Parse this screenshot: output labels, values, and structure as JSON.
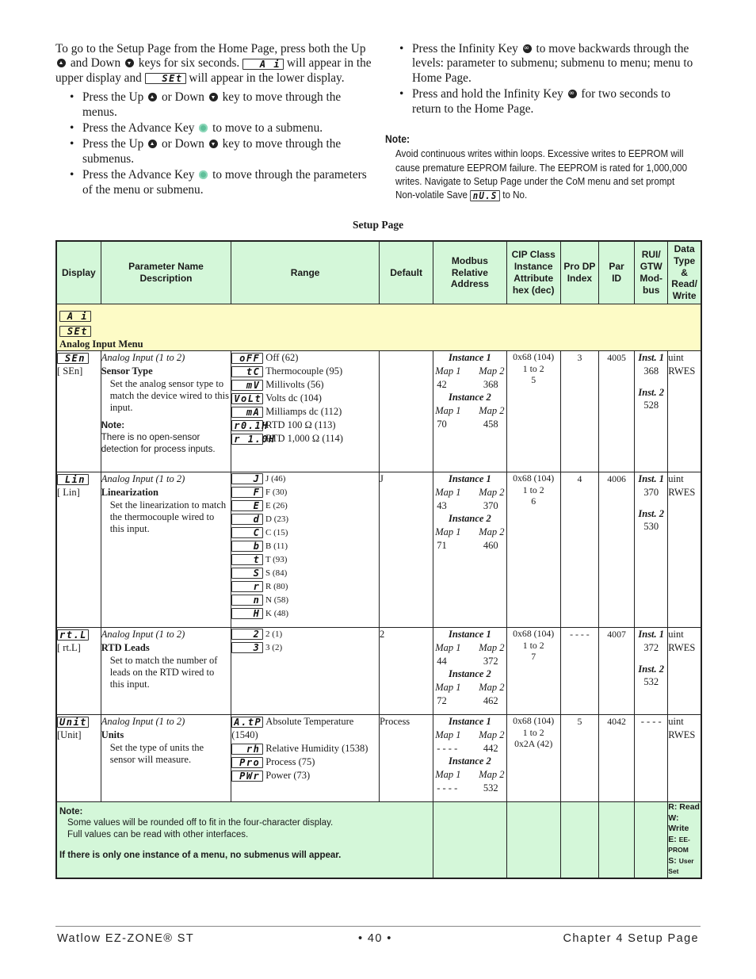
{
  "intro": {
    "paragraph": {
      "part1": "To go to the Setup Page from the Home Page, press both the Up",
      "part2": "and Down",
      "part3": "keys for six seconds.",
      "display1": "A i",
      "part4": "will appear in the upper display and",
      "display2": "SEt",
      "part5": "will appear in the lower display."
    },
    "bullets_left": [
      {
        "a": "Press the Up",
        "b": "or Down",
        "c": "key to move through the menus."
      },
      {
        "a": "Press the Advance Key",
        "c": "to move to a submenu."
      },
      {
        "a": "Press the Up",
        "b": "or Down",
        "c": "key to move through the submenus."
      },
      {
        "a": "Press the Advance Key",
        "c": "to move through the parameters of the menu or submenu."
      }
    ],
    "bullets_right": [
      {
        "a": "Press the Infinity Key",
        "c": "to move backwards through the levels: parameter to submenu; submenu to menu; menu to Home Page."
      },
      {
        "a": "Press and hold the Infinity Key",
        "c": "for two seconds to return to the Home Page."
      }
    ],
    "note": {
      "heading": "Note:",
      "body1": "Avoid continuous writes within loops. Excessive writes to EEPROM will cause premature EEPROM failure. The EEPROM is rated for 1,000,000 writes. Navigate to Setup Page under the CoM menu and set prompt Non-volatile Save",
      "display": "nU.S",
      "body2": "to No."
    }
  },
  "table": {
    "title": "Setup Page",
    "headers": {
      "display": "Display",
      "param": "Parameter Name Description",
      "range": "Range",
      "default": "Default",
      "modbus": "Modbus Relative Address",
      "cip": "CIP Class Instance Attribute hex (dec)",
      "prodp": "Pro DP Index",
      "parid": "Par ID",
      "rui": "RUI/ GTW Mod- bus",
      "datatype": "Data Type & Read/ Write"
    },
    "menu": {
      "display_upper": "A i",
      "display_lower": "SEt",
      "label": "Analog Input Menu"
    },
    "rows": [
      {
        "display": "SEn",
        "display_alt": "[ SEn]",
        "context": "Analog Input (1 to 2)",
        "name": "Sensor Type",
        "description": "Set the analog sensor type to match the device wired to this input.",
        "note_heading": "Note:",
        "note": "There is no open-sensor detection for process inputs.",
        "range": [
          {
            "display": "oFF",
            "label": "Off (62)"
          },
          {
            "display": "tC",
            "label": "Thermocouple (95)"
          },
          {
            "display": "mV",
            "label": "Millivolts (56)"
          },
          {
            "display": "VoLt",
            "label": "Volts dc (104)"
          },
          {
            "display": "mA",
            "label": "Milliamps dc (112)"
          },
          {
            "display": "r0.1H",
            "label": "RTD 100 Ω (113)"
          },
          {
            "display": "r 1.0H",
            "label": "RTD 1,000 Ω (114)"
          }
        ],
        "default": "",
        "modbus": {
          "inst1_label": "Instance 1",
          "inst2_label": "Instance 2",
          "map1_label": "Map 1",
          "map2_label": "Map 2",
          "i1m1": "42",
          "i1m2": "368",
          "i2m1": "70",
          "i2m2": "458"
        },
        "cip": [
          "0x68 (104)",
          "1 to 2",
          "5"
        ],
        "prodp": "3",
        "parid": "4005",
        "rui": {
          "inst1_label": "Inst. 1",
          "inst1": "368",
          "inst2_label": "Inst. 2",
          "inst2": "528"
        },
        "datatype": [
          "uint",
          "RWES"
        ]
      },
      {
        "display": "Lin",
        "display_alt": "[ Lin]",
        "context": "Analog Input (1 to 2)",
        "name": "Linearization",
        "description": "Set the linearization to match the thermocouple wired to this input.",
        "range": [
          {
            "display": "J",
            "label": "J (46)"
          },
          {
            "display": "F",
            "label": "F (30)"
          },
          {
            "display": "E",
            "label": "E (26)"
          },
          {
            "display": "d",
            "label": "D (23)"
          },
          {
            "display": "C",
            "label": "C (15)"
          },
          {
            "display": "b",
            "label": "B (11)"
          },
          {
            "display": "t",
            "label": "T (93)"
          },
          {
            "display": "S",
            "label": "S (84)"
          },
          {
            "display": "r",
            "label": "R (80)"
          },
          {
            "display": "n",
            "label": "N (58)"
          },
          {
            "display": "H",
            "label": "K (48)"
          }
        ],
        "default": "J",
        "modbus": {
          "inst1_label": "Instance 1",
          "inst2_label": "Instance 2",
          "map1_label": "Map 1",
          "map2_label": "Map 2",
          "i1m1": "43",
          "i1m2": "370",
          "i2m1": "71",
          "i2m2": "460"
        },
        "cip": [
          "0x68 (104)",
          "1 to 2",
          "6"
        ],
        "prodp": "4",
        "parid": "4006",
        "rui": {
          "inst1_label": "Inst. 1",
          "inst1": "370",
          "inst2_label": "Inst. 2",
          "inst2": "530"
        },
        "datatype": [
          "uint",
          "RWES"
        ]
      },
      {
        "display": "rt.L",
        "display_alt": "[ rt.L]",
        "context": "Analog Input (1 to 2)",
        "name": "RTD Leads",
        "description": "Set to match the number of leads on the RTD wired to this input.",
        "range": [
          {
            "display": "2",
            "label": "2 (1)"
          },
          {
            "display": "3",
            "label": "3 (2)"
          }
        ],
        "default": "2",
        "modbus": {
          "inst1_label": "Instance 1",
          "inst2_label": "Instance 2",
          "map1_label": "Map 1",
          "map2_label": "Map 2",
          "i1m1": "44",
          "i1m2": "372",
          "i2m1": "72",
          "i2m2": "462"
        },
        "cip": [
          "0x68 (104)",
          "1 to 2",
          "7"
        ],
        "prodp": "- - - -",
        "parid": "4007",
        "rui": {
          "inst1_label": "Inst. 1",
          "inst1": "372",
          "inst2_label": "Inst. 2",
          "inst2": "532"
        },
        "datatype": [
          "uint",
          "RWES"
        ]
      },
      {
        "display": "Unit",
        "display_alt": "[Unit]",
        "context": "Analog Input (1 to 2)",
        "name": "Units",
        "description": "Set the type of units the sensor will measure.",
        "range": [
          {
            "display": "A.tP",
            "label": "Absolute Temperature (1540)"
          },
          {
            "display": "rh",
            "label": "Relative Humidity (1538)"
          },
          {
            "display": "Pro",
            "label": "Process (75)"
          },
          {
            "display": "PWr",
            "label": "Power (73)"
          }
        ],
        "default": "Process",
        "modbus": {
          "inst1_label": "Instance 1",
          "inst2_label": "Instance 2",
          "map1_label": "Map 1",
          "map2_label": "Map 2",
          "i1m1": "- - - -",
          "i1m2": "442",
          "i2m1": "- - - -",
          "i2m2": "532"
        },
        "cip": [
          "0x68 (104)",
          "1 to 2",
          "0x2A (42)"
        ],
        "prodp": "5",
        "parid": "4042",
        "rui": {
          "dash": "- - - -"
        },
        "datatype": [
          "uint",
          "RWES"
        ]
      }
    ],
    "footnote": {
      "heading": "Note:",
      "line1": "Some values will be rounded off to fit in the four-character display.",
      "line2": "Full values can be read with other interfaces.",
      "line3": "If there is only one instance of a menu, no submenus will appear."
    },
    "legend": {
      "r": "R: Read",
      "w": "W: Write",
      "e1": "E:",
      "e2": "EE-",
      "e3": "PROM",
      "s1": "S:",
      "s2": "User",
      "s3": "Set"
    }
  },
  "footer": {
    "left": "Watlow EZ-ZONE® ST",
    "center": "• 40 •",
    "right": "Chapter 4 Setup Page"
  }
}
